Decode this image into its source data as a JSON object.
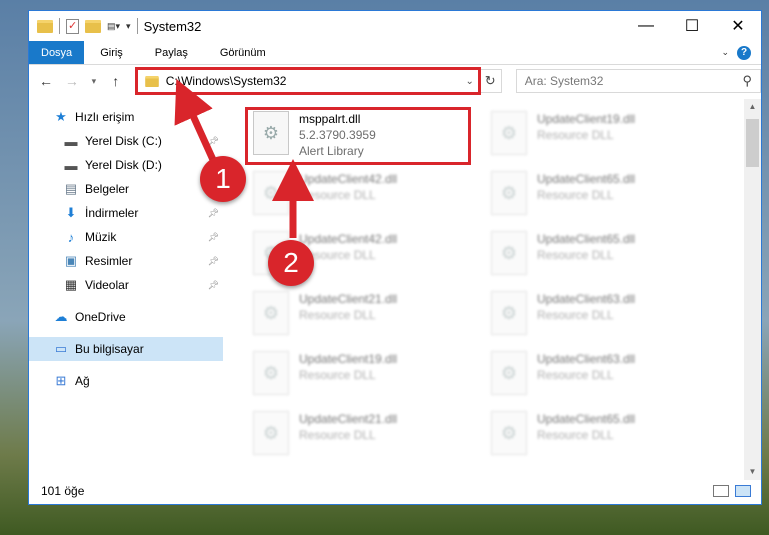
{
  "window": {
    "title": "System32",
    "controls": {
      "minimize": "—",
      "maximize": "☐",
      "close": "✕"
    }
  },
  "ribbon": {
    "tabs": [
      "Dosya",
      "Giriş",
      "Paylaş",
      "Görünüm"
    ],
    "active_tab": "Dosya"
  },
  "address": {
    "path": "C:\\Windows\\System32",
    "search_placeholder": "Ara: System32"
  },
  "sidebar": {
    "items": [
      {
        "label": "Hızlı erişim",
        "icon": "star-icon"
      },
      {
        "label": "Yerel Disk (C:)",
        "icon": "drive-icon",
        "pinned": true
      },
      {
        "label": "Yerel Disk (D:)",
        "icon": "drive-icon"
      },
      {
        "label": "Belgeler",
        "icon": "documents-icon",
        "pinned": true
      },
      {
        "label": "İndirmeler",
        "icon": "download-icon",
        "pinned": true
      },
      {
        "label": "Müzik",
        "icon": "music-icon",
        "pinned": true
      },
      {
        "label": "Resimler",
        "icon": "pictures-icon",
        "pinned": true
      },
      {
        "label": "Videolar",
        "icon": "video-icon",
        "pinned": true
      },
      {
        "label": "OneDrive",
        "icon": "cloud-icon"
      },
      {
        "label": "Bu bilgisayar",
        "icon": "computer-icon",
        "selected": true
      },
      {
        "label": "Ağ",
        "icon": "network-icon"
      }
    ]
  },
  "files": [
    {
      "name": "msppalrt.dll",
      "version": "5.2.3790.3959",
      "desc": "Alert Library",
      "highlighted": true
    },
    {
      "name": "UpdateClient19.dll",
      "desc": "Resource DLL"
    },
    {
      "name": "UpdateClient42.dll",
      "desc": "Resource DLL"
    },
    {
      "name": "UpdateClient65.dll",
      "desc": "Resource DLL"
    },
    {
      "name": "UpdateClient42.dll",
      "desc": "Resource DLL"
    },
    {
      "name": "UpdateClient65.dll",
      "desc": "Resource DLL"
    },
    {
      "name": "UpdateClient21.dll",
      "desc": "Resource DLL"
    },
    {
      "name": "UpdateClient63.dll",
      "desc": "Resource DLL"
    },
    {
      "name": "UpdateClient19.dll",
      "desc": "Resource DLL"
    },
    {
      "name": "UpdateClient63.dll",
      "desc": "Resource DLL"
    },
    {
      "name": "UpdateClient21.dll",
      "desc": "Resource DLL"
    },
    {
      "name": "UpdateClient65.dll",
      "desc": "Resource DLL"
    }
  ],
  "status": {
    "item_count": "101 öğe"
  },
  "annotations": {
    "step1": "1",
    "step2": "2",
    "color": "#d9252b"
  }
}
